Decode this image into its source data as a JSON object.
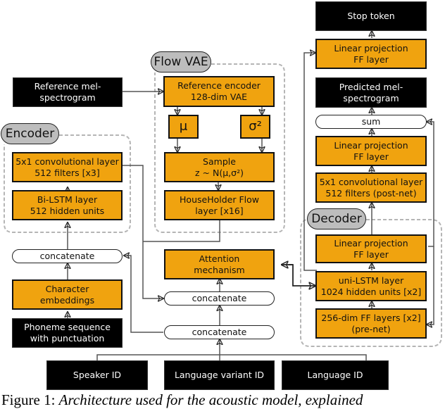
{
  "groups": {
    "flow_vae": "Flow VAE",
    "encoder": "Encoder",
    "decoder": "Decoder"
  },
  "nodes": {
    "stop_token": "Stop token",
    "linear_proj_stop": "Linear projection\nFF layer",
    "predicted_mel": "Predicted mel-\nspectrogram",
    "sum": "sum",
    "linear_proj_post": "Linear projection\nFF layer",
    "postnet": "5x1 convolutional layer\n512 filters (post-net)",
    "reference_mel": "Reference mel-\nspectrogram",
    "reference_encoder": "Reference encoder\n128-dim VAE",
    "mu": "μ",
    "sigma": "σ²",
    "sample": "Sample\nz ~ N(μ,σ²)",
    "householder": "HouseHolder Flow\nlayer [x16]",
    "enc_conv": "5x1 convolutional layer\n512 filters [x3]",
    "bilstm": "Bi-LSTM layer\n512 hidden units",
    "concat_enc": "concatenate",
    "char_emb": "Character\nembeddings",
    "phoneme_seq": "Phoneme sequence\nwith punctuation",
    "attention": "Attention\nmechanism",
    "concat_upper": "concatenate",
    "concat_lower": "concatenate",
    "linear_proj_dec": "Linear projection\nFF layer",
    "uni_lstm": "uni-LSTM layer\n1024 hidden units [x2]",
    "prenet": "256-dim FF layers [x2]\n(pre-net)",
    "speaker_id": "Speaker ID",
    "lang_variant_id": "Language variant ID",
    "language_id": "Language ID"
  },
  "caption": {
    "label": "Figure 1:",
    "text": "Architecture used for the acoustic model, explained"
  },
  "colors": {
    "layer_fill": "#f0a30f",
    "io_fill": "#000000",
    "group_label_fill": "#bdbdbd",
    "group_border": "#b5b5b5"
  }
}
